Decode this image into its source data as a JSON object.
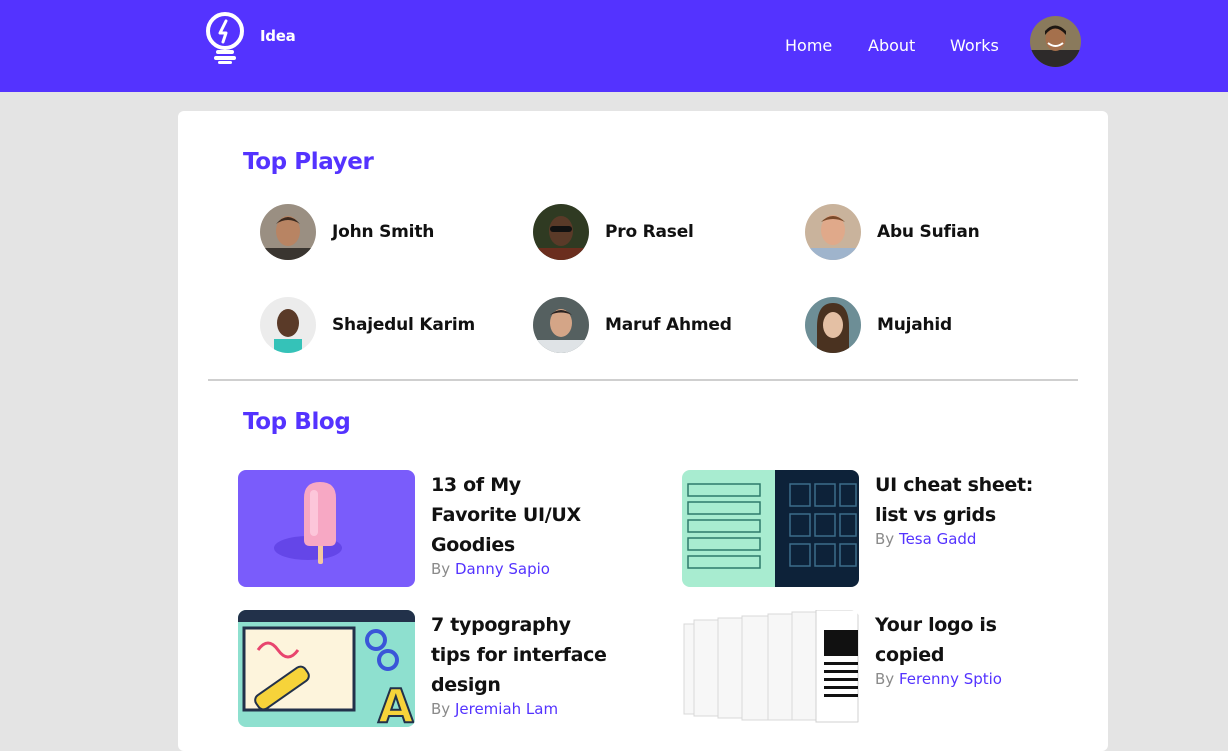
{
  "brand": {
    "name": "Idea",
    "icon": "lightbulb-icon"
  },
  "nav": {
    "links": [
      "Home",
      "About",
      "Works"
    ],
    "avatar": "user-avatar"
  },
  "colors": {
    "accent": "#5433ff",
    "page_bg": "#e4e4e4",
    "card_bg": "#ffffff"
  },
  "top_player": {
    "title": "Top Player",
    "players": [
      {
        "name": "John Smith"
      },
      {
        "name": "Pro Rasel"
      },
      {
        "name": "Abu Sufian"
      },
      {
        "name": "Shajedul Karim"
      },
      {
        "name": "Maruf Ahmed"
      },
      {
        "name": "Mujahid"
      }
    ]
  },
  "top_blog": {
    "title": "Top Blog",
    "by_label": "By",
    "posts": [
      {
        "title": "13 of My Favorite UI/UX Goodies",
        "author": "Danny Sapio"
      },
      {
        "title": "UI cheat sheet: list vs grids",
        "author": "Tesa Gadd"
      },
      {
        "title": "7 typography tips for interface design",
        "author": "Jeremiah Lam"
      },
      {
        "title": "Your logo is copied",
        "author": "Ferenny Sptio"
      }
    ]
  }
}
